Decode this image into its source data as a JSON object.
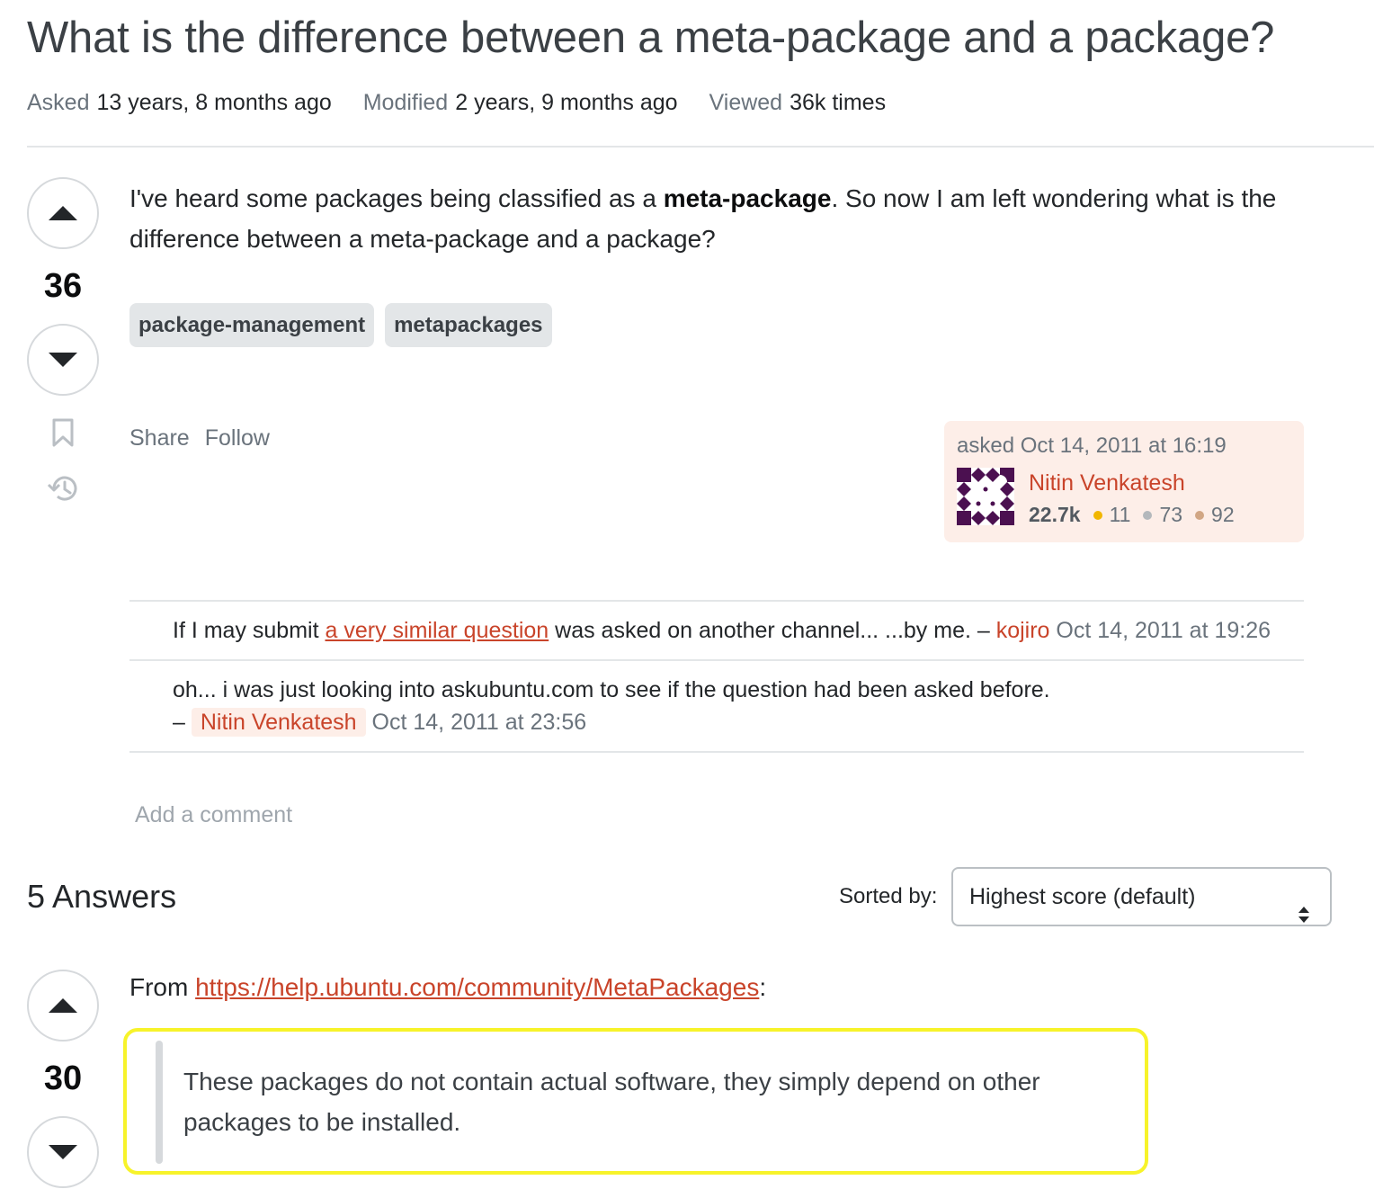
{
  "question": {
    "title": "What is the difference between a meta-package and a package?",
    "meta": {
      "asked_label": "Asked",
      "asked_value": "13 years, 8 months ago",
      "modified_label": "Modified",
      "modified_value": "2 years, 9 months ago",
      "viewed_label": "Viewed",
      "viewed_value": "36k times"
    },
    "score": "36",
    "body_part1": "I've heard some packages being classified as a ",
    "body_bold": "meta-package",
    "body_part2": ". So now I am left wondering what is the difference between a meta-package and a package?",
    "tags": [
      "package-management",
      "metapackages"
    ],
    "share_label": "Share",
    "follow_label": "Follow",
    "owner": {
      "asked_text": "asked Oct 14, 2011 at 16:19",
      "name": "Nitin Venkatesh",
      "reputation": "22.7k",
      "gold": "11",
      "silver": "73",
      "bronze": "92"
    },
    "comments": [
      {
        "text_before": "If I may submit ",
        "link_text": "a very similar question",
        "text_after": " was asked on another channel... ...by me. – ",
        "user": "kojiro",
        "date": "Oct 14, 2011 at 19:26"
      },
      {
        "text": "oh... i was just looking into askubuntu.com to see if the question had been asked before.",
        "dash": "–",
        "user": "Nitin Venkatesh",
        "date": "Oct 14, 2011 at 23:56"
      }
    ],
    "add_comment": "Add a comment"
  },
  "answers": {
    "header": "5 Answers",
    "sort_label": "Sorted by:",
    "sort_value": "Highest score (default)"
  },
  "answer1": {
    "score": "30",
    "intro_text": "From ",
    "link": "https://help.ubuntu.com/community/MetaPackages",
    "colon": ":",
    "quote": "These packages do not contain actual software, they simply depend on other packages to be installed."
  },
  "colors": {
    "link": "#c9442a",
    "owner_card_bg": "#fdeee8",
    "highlight": "#f7f32a",
    "gold": "#f1b600",
    "silver": "#b4b8bc",
    "bronze": "#d1a684"
  },
  "icons": {
    "upvote": "triangle-up-icon",
    "downvote": "triangle-down-icon",
    "bookmark": "bookmark-icon",
    "history": "history-icon",
    "sort": "sort-arrows-icon"
  }
}
